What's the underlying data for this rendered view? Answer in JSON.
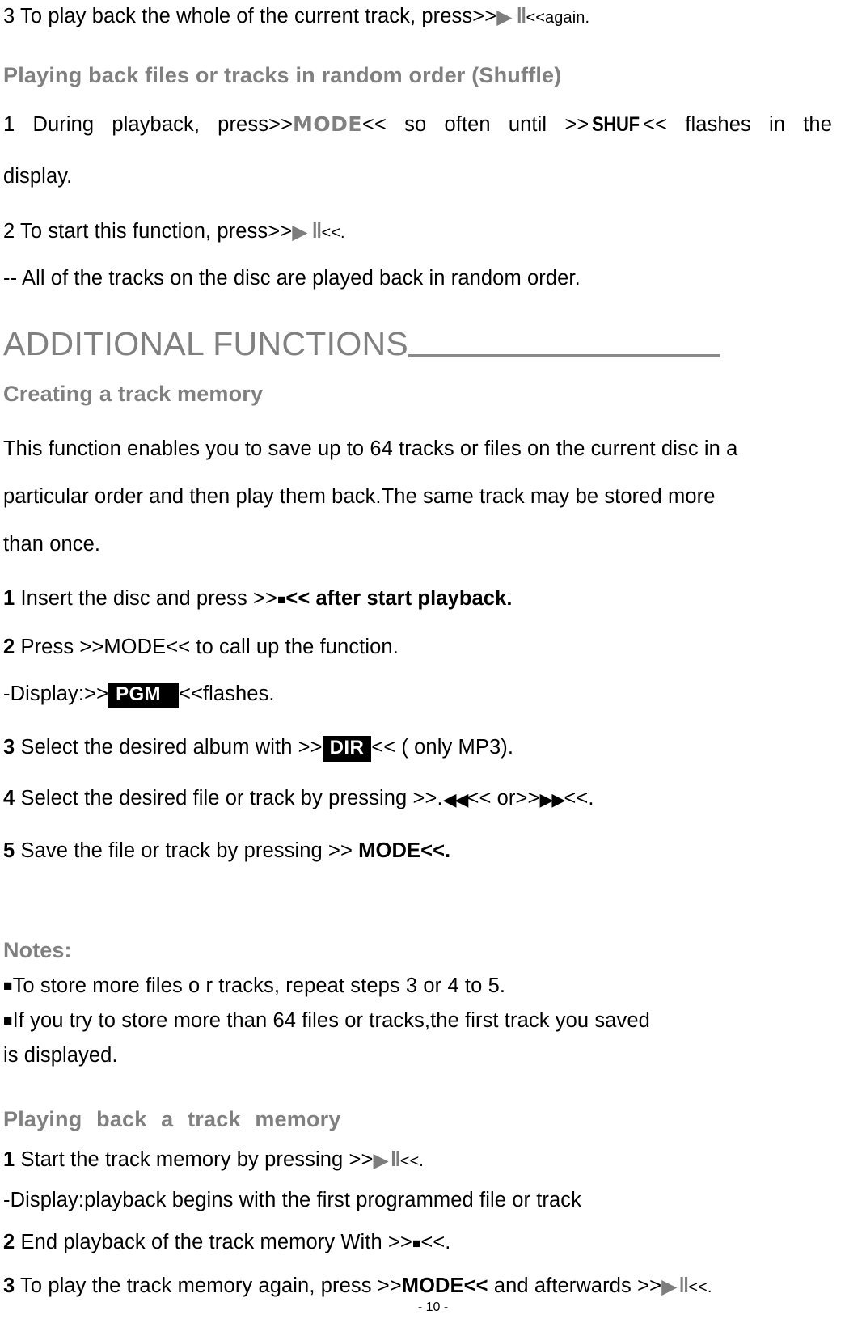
{
  "document": {
    "page_number": "- 10 -",
    "colors": {
      "heading_gray": "#808080",
      "body_black": "#000000",
      "icon_gray": "#7d7d7d",
      "badge_background": "#000000",
      "badge_text": "#ffffff"
    }
  },
  "icons": {
    "play": "▶",
    "pause": "‖",
    "stop": "■",
    "prev": "◀◀",
    "next": "▶▶",
    "bullet_square": "■"
  },
  "sections": [
    {
      "id": "shuffle-step-3-prev",
      "step": "3",
      "text_before": " To play back the whole of the current track, press>>",
      "text_after": "<<again."
    },
    {
      "id": "shuffle-heading",
      "heading": "Playing back files or tracks in random order (Shuffle)"
    },
    {
      "id": "shuffle-step-1",
      "step": "1",
      "part_a": "During   playback,   press>>",
      "keyword_1": "MODE",
      "part_b": "<<   so   often   until   >>",
      "keyword_2": "SHUF",
      "part_c": "<<   flashes   in   the",
      "continuation": "display."
    },
    {
      "id": "shuffle-step-2",
      "step": "2",
      "text_before": " To start this function, press>>",
      "text_after": "<<."
    },
    {
      "id": "shuffle-note",
      "text": "-- All of the tracks on the disc are played back in random order."
    },
    {
      "id": "additional-functions-heading",
      "heading": "ADDITIONAL FUNCTIONS"
    },
    {
      "id": "creating-track-memory-heading",
      "heading": "Creating   a track memory"
    },
    {
      "id": "creating-intro",
      "line_1": "This function enables you to save up to 64 tracks or files on the current disc in a",
      "line_2": "particular order and then play them back.The same    track may be stored more",
      "line_3": "than once."
    },
    {
      "id": "creating-step-1",
      "step": "1",
      "text_before": " Insert the disc and press >>",
      "text_after": "<< after start playback."
    },
    {
      "id": "creating-step-2",
      "step": "2",
      "text": " Press >>MODE<< to call up the   function."
    },
    {
      "id": "creating-display-pgm",
      "text_before": "-Display:>>",
      "badge": "PGM",
      "text_after": "<<flashes."
    },
    {
      "id": "creating-step-3",
      "step": "3",
      "text_before": " Select the desired album with >>",
      "badge": "DIR",
      "text_after": "<< ( only MP3)."
    },
    {
      "id": "creating-step-4",
      "step": "4",
      "text_before": " Select the desired file or track by pressing >>.",
      "text_middle": "<< or>>",
      "text_after": "<<."
    },
    {
      "id": "creating-step-5",
      "step": "5",
      "text_before": " Save the file or track by pressing >> ",
      "keyword": "MODE<<."
    },
    {
      "id": "notes-heading",
      "heading": "Notes:"
    },
    {
      "id": "note-1",
      "text": "To store more files o r tracks, repeat steps 3 or 4 to 5."
    },
    {
      "id": "note-2",
      "line_1": "If    you try    to    store    more than 64 files or    tracks,the first    track    you saved",
      "line_2": "is displayed."
    },
    {
      "id": "playing-track-memory-heading",
      "heading": "Playing   back   a   track   memory"
    },
    {
      "id": "playing-step-1",
      "step": "1",
      "text_before": " Start the track memory by pressing >>",
      "text_after": "<<."
    },
    {
      "id": "playing-display",
      "text": "-Display:playback begins with the first programmed file or track"
    },
    {
      "id": "playing-step-2",
      "step": "2",
      "text_before": " End playback of the track memory With >>",
      "text_after": "<<."
    },
    {
      "id": "playing-step-3",
      "step": "3",
      "text_before": " To play the track memory again, press >>",
      "keyword": "MODE<<",
      "text_middle": " and   afterwards >>",
      "text_after": "<<."
    }
  ]
}
